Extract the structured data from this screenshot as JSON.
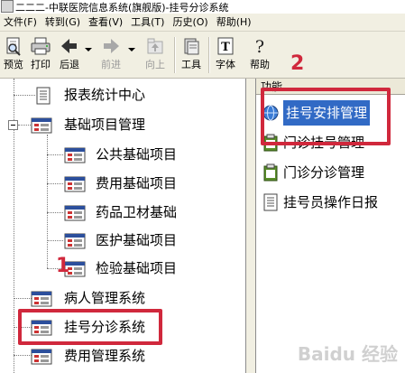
{
  "window": {
    "title": "二二二-中联医院信息系统(旗舰版)-挂号分诊系统"
  },
  "menu": [
    {
      "label": "文件(F)"
    },
    {
      "label": "转到(G)"
    },
    {
      "label": "查看(V)"
    },
    {
      "label": "工具(T)"
    },
    {
      "label": "历史(O)"
    },
    {
      "label": "帮助(H)"
    }
  ],
  "toolbar": {
    "preview": "预览",
    "print": "打印",
    "back": "后退",
    "forward": "前进",
    "up": "向上",
    "tools": "工具",
    "font": "字体",
    "help": "帮助"
  },
  "annotations": {
    "step1": "1",
    "step2": "2"
  },
  "tree": [
    {
      "label": "报表统计中心"
    },
    {
      "label": "基础项目管理"
    },
    {
      "label": "公共基础项目"
    },
    {
      "label": "费用基础项目"
    },
    {
      "label": "药品卫材基础"
    },
    {
      "label": "医护基础项目"
    },
    {
      "label": "检验基础项目"
    },
    {
      "label": "病人管理系统"
    },
    {
      "label": "挂号分诊系统"
    },
    {
      "label": "费用管理系统"
    }
  ],
  "functions": {
    "header": "功能",
    "items": [
      {
        "label": "挂号安排管理"
      },
      {
        "label": "门诊挂号管理"
      },
      {
        "label": "门诊分诊管理"
      },
      {
        "label": "挂号员操作日报"
      }
    ]
  },
  "watermark": "Baidu 经验",
  "colors": {
    "highlight": "#d0283c",
    "selection": "#316ac5",
    "toolbar_bg": "#f1efe2"
  }
}
